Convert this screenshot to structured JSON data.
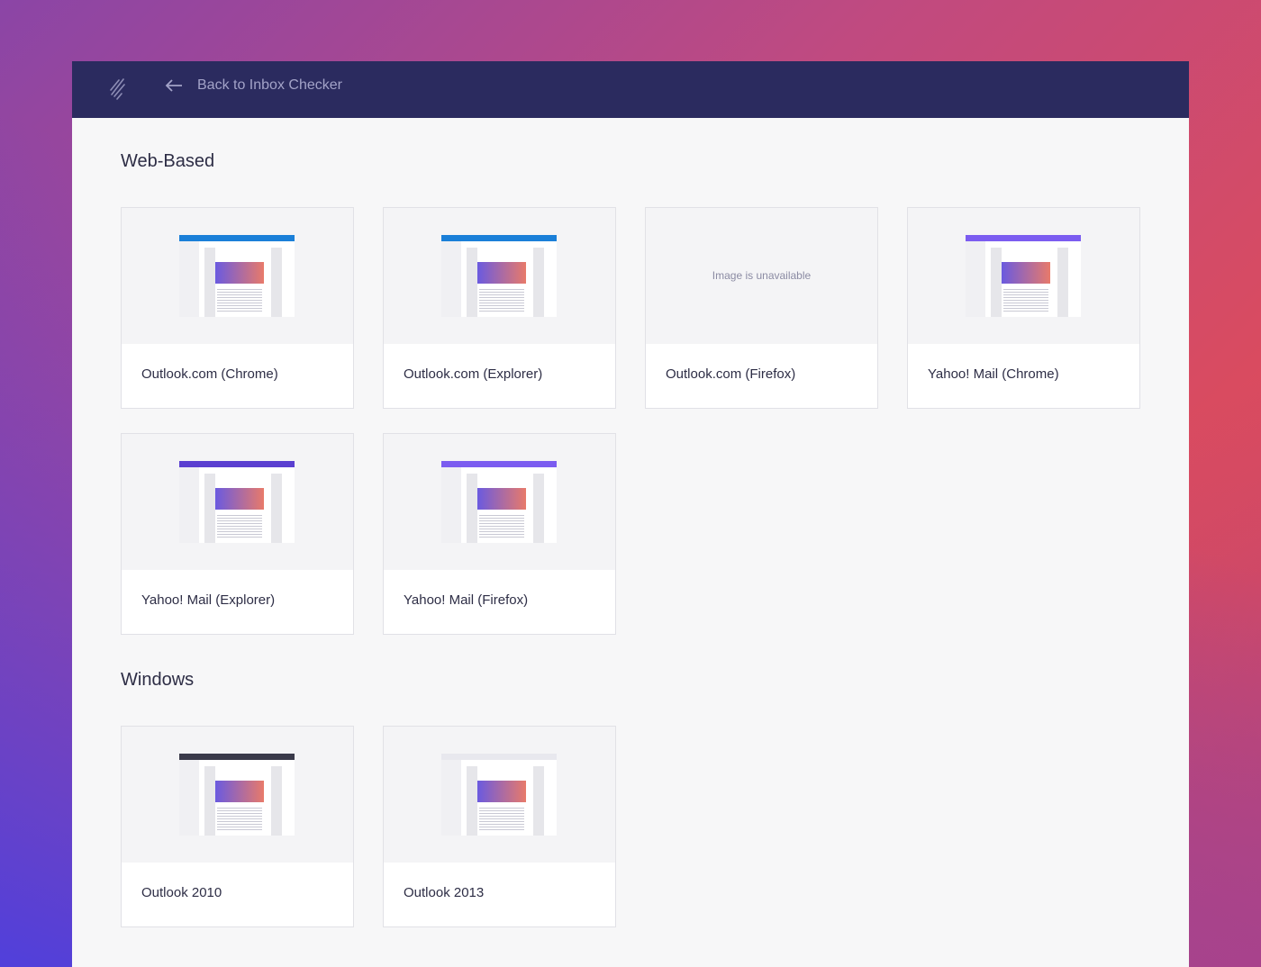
{
  "header": {
    "back_label": "Back to Inbox Checker"
  },
  "sections": [
    {
      "title": "Web-Based",
      "cards": [
        {
          "label": "Outlook.com (Chrome)",
          "bar_color": "#1a7fd8",
          "available": true
        },
        {
          "label": "Outlook.com (Explorer)",
          "bar_color": "#1a7fd8",
          "available": true
        },
        {
          "label": "Outlook.com (Firefox)",
          "available": false,
          "unavailable_text": "Image is unavailable"
        },
        {
          "label": "Yahoo! Mail (Chrome)",
          "bar_color": "#7b5cf0",
          "available": true
        },
        {
          "label": "Yahoo! Mail (Explorer)",
          "bar_color": "#5a3fd0",
          "available": true
        },
        {
          "label": "Yahoo! Mail (Firefox)",
          "bar_color": "#7b5cf0",
          "available": true
        }
      ]
    },
    {
      "title": "Windows",
      "cards": [
        {
          "label": "Outlook 2010",
          "bar_color": "#3a3a4a",
          "available": true
        },
        {
          "label": "Outlook 2013",
          "bar_color": "#e8e8ee",
          "available": true
        }
      ]
    }
  ]
}
